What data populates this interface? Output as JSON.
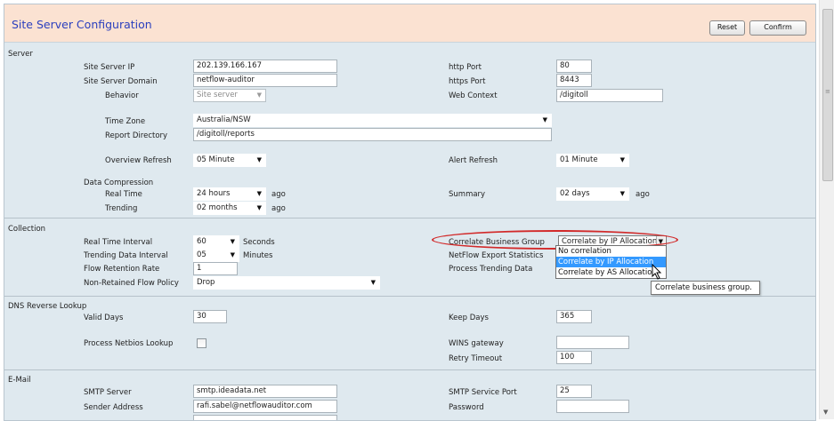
{
  "header": {
    "title": "Site Server Configuration",
    "reset_label": "Reset",
    "confirm_label": "Confirm"
  },
  "server": {
    "section_title": "Server",
    "site_server_ip_label": "Site Server IP",
    "site_server_ip_value": "202.139.166.167",
    "http_port_label": "http Port",
    "http_port_value": "80",
    "site_server_domain_label": "Site Server Domain",
    "site_server_domain_value": "netflow-auditor",
    "https_port_label": "https Port",
    "https_port_value": "8443",
    "behavior_label": "Behavior",
    "behavior_value": "Site server",
    "web_context_label": "Web Context",
    "web_context_value": "/digitoll",
    "time_zone_label": "Time Zone",
    "time_zone_value": "Australia/NSW",
    "report_directory_label": "Report Directory",
    "report_directory_value": "/digitoll/reports",
    "overview_refresh_label": "Overview Refresh",
    "overview_refresh_value": "05 Minute",
    "alert_refresh_label": "Alert Refresh",
    "alert_refresh_value": "01 Minute",
    "data_compression_label": "Data Compression",
    "real_time_label": "Real Time",
    "real_time_value": "24 hours",
    "real_time_suffix": "ago",
    "summary_label": "Summary",
    "summary_value": "02 days",
    "summary_suffix": "ago",
    "trending_label": "Trending",
    "trending_value": "02 months",
    "trending_suffix": "ago"
  },
  "collection": {
    "section_title": "Collection",
    "real_time_interval_label": "Real Time Interval",
    "real_time_interval_value": "60",
    "real_time_interval_unit": "Seconds",
    "correlate_business_group_label": "Correlate Business Group",
    "correlate_business_group_value": "Correlate by IP Allocation",
    "trending_data_interval_label": "Trending Data Interval",
    "trending_data_interval_value": "05",
    "trending_data_interval_unit": "Minutes",
    "netflow_export_statistics_label": "NetFlow Export Statistics",
    "flow_retention_rate_label": "Flow Retention Rate",
    "flow_retention_rate_value": "1",
    "process_trending_data_label": "Process Trending Data",
    "non_retained_flow_policy_label": "Non-Retained Flow Policy",
    "non_retained_flow_policy_value": "Drop",
    "dropdown_options": [
      "No correlation",
      "Correlate by IP Allocation",
      "Correlate by AS Allocation"
    ],
    "tooltip": "Correlate business group."
  },
  "dns": {
    "section_title": "DNS Reverse Lookup",
    "valid_days_label": "Valid Days",
    "valid_days_value": "30",
    "keep_days_label": "Keep Days",
    "keep_days_value": "365",
    "process_netbios_lookup_label": "Process Netbios Lookup",
    "wins_gateway_label": "WINS gateway",
    "wins_gateway_value": "",
    "retry_timeout_label": "Retry Timeout",
    "retry_timeout_value": "100"
  },
  "email": {
    "section_title": "E-Mail",
    "smtp_server_label": "SMTP Server",
    "smtp_server_value": "smtp.ideadata.net",
    "smtp_service_port_label": "SMTP Service Port",
    "smtp_service_port_value": "25",
    "sender_address_label": "Sender Address",
    "sender_address_value": "rafi.sabel@netflowauditor.com",
    "password_label": "Password",
    "password_value": ""
  }
}
